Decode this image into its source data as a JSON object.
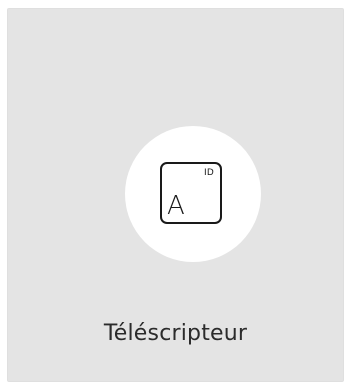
{
  "tile": {
    "label": "Téléscripteur",
    "background_color": "#e4e4e4",
    "icon": {
      "name": "ticker-id-icon",
      "badge_text": "ID",
      "letter": "A"
    }
  }
}
